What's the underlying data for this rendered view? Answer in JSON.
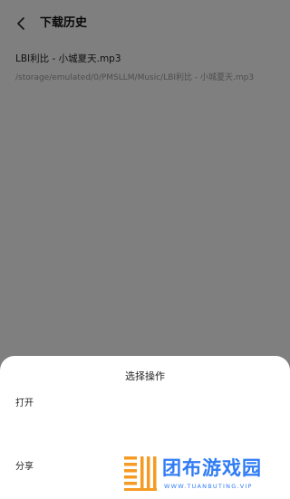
{
  "header": {
    "back_icon": "chevron-left-icon",
    "title": "下载历史"
  },
  "history": {
    "items": [
      {
        "title": "LBI利比 - 小城夏天.mp3",
        "path": "/storage/emulated/0/PMSLLM/Music/LBI利比 - 小城夏天.mp3"
      }
    ]
  },
  "sheet": {
    "title": "选择操作",
    "options": [
      {
        "label": "打开"
      },
      {
        "label": "分享"
      }
    ]
  },
  "watermark": {
    "name": "团布游戏园",
    "url": "WWW.TUANBUTING.VIP"
  },
  "colors": {
    "overlay": "rgba(0,0,0,0.5)",
    "watermark_blue": "#2f7cf6",
    "watermark_orange": "#f59a23"
  }
}
